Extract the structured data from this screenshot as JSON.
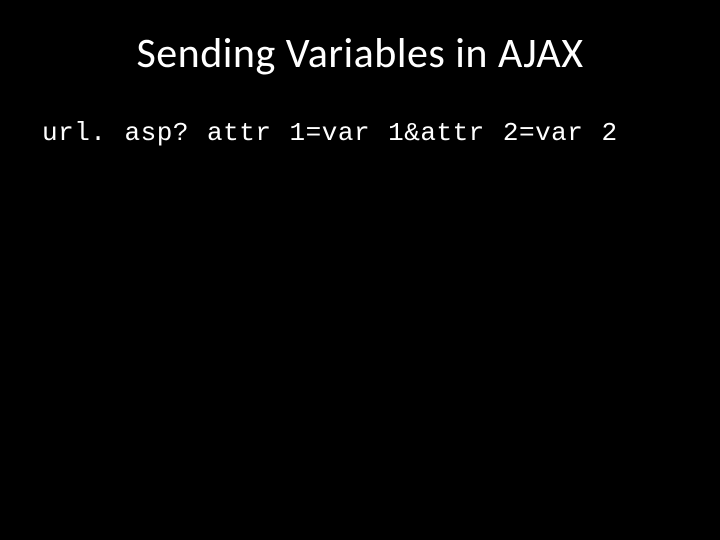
{
  "slide": {
    "title": "Sending Variables in AJAX",
    "code": "url. asp? attr 1=var 1&attr 2=var 2"
  }
}
